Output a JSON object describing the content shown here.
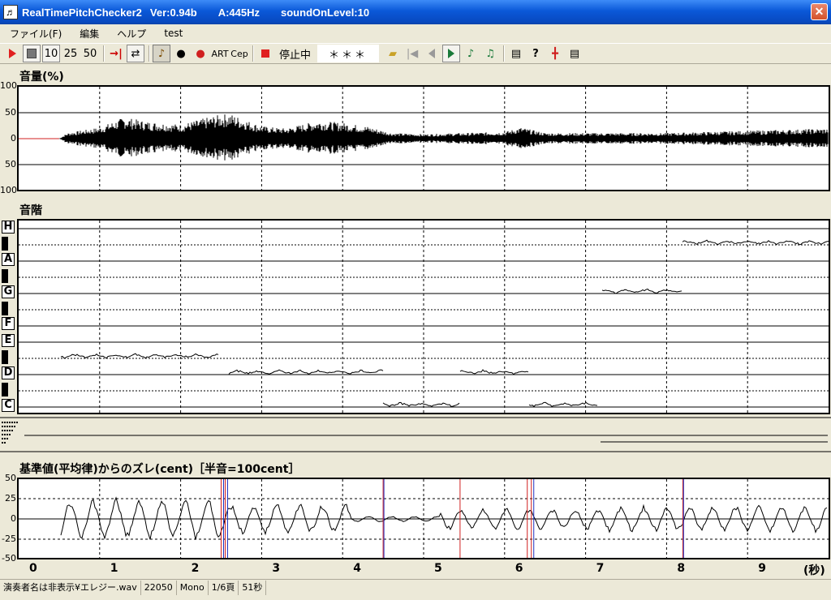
{
  "window": {
    "title_parts": [
      "RealTimePitchChecker2",
      "Ver:0.94b",
      "A:445Hz",
      "soundOnLevel:10"
    ],
    "close_glyph": "✕"
  },
  "menu": [
    "ファイル(F)",
    "編集",
    "ヘルプ",
    "test"
  ],
  "toolbar": {
    "speed_buttons": [
      "10",
      "25",
      "50"
    ],
    "art_label": "ART",
    "cep_label": "Cep",
    "state_label": "停止中",
    "display_value": "＊＊＊"
  },
  "panels": {
    "volume": {
      "title": "音量(%)",
      "yticks": [
        "100",
        "50",
        "0",
        "50",
        "100"
      ]
    },
    "scale": {
      "title": "音階",
      "notes": [
        "H",
        "A",
        "G",
        "F",
        "E",
        "D",
        "C"
      ]
    },
    "deviation": {
      "title": "基準値(平均律)からのズレ(cent)［半音=100cent］",
      "yticks": [
        "50",
        "25",
        "0",
        "-25",
        "-50"
      ]
    }
  },
  "x_axis": {
    "ticks": [
      "0",
      "1",
      "2",
      "3",
      "4",
      "5",
      "6",
      "7",
      "8",
      "9"
    ],
    "unit": "(秒)"
  },
  "status": [
    "演奏者名は非表示¥エレジー.wav",
    "22050",
    "Mono",
    "1/6頁",
    "51秒"
  ],
  "chart_data": [
    {
      "type": "area",
      "ylabel": "音量(%)",
      "ylim": [
        -100,
        100
      ],
      "xlim": [
        0,
        10
      ],
      "envelope": {
        "x": [
          0.0,
          0.5,
          0.6,
          1.0,
          1.3,
          1.6,
          2.0,
          2.4,
          2.6,
          3.0,
          3.3,
          3.7,
          4.0,
          4.3,
          4.6,
          5.0,
          5.5,
          6.0,
          6.2,
          6.5,
          7.0,
          7.5,
          8.0,
          8.5,
          9.0,
          9.5,
          10.0
        ],
        "amp": [
          0,
          0,
          10,
          20,
          38,
          30,
          25,
          40,
          45,
          22,
          18,
          32,
          28,
          22,
          10,
          8,
          10,
          12,
          20,
          10,
          10,
          10,
          10,
          12,
          14,
          16,
          18
        ]
      }
    },
    {
      "type": "line",
      "ylabel": "音階",
      "categories": [
        "C",
        "C#",
        "D",
        "D#",
        "E",
        "F",
        "F#",
        "G",
        "G#",
        "A",
        "A#",
        "H"
      ],
      "xlim": [
        0,
        10
      ],
      "pitch_segments": [
        {
          "x": [
            0.52,
            2.47
          ],
          "note": "D#"
        },
        {
          "x": [
            2.6,
            4.5
          ],
          "note": "D"
        },
        {
          "x": [
            4.5,
            5.45
          ],
          "note": "C"
        },
        {
          "x": [
            5.45,
            6.3
          ],
          "note": "D"
        },
        {
          "x": [
            6.3,
            7.15
          ],
          "note": "C"
        },
        {
          "x": [
            7.2,
            8.2
          ],
          "note": "G"
        },
        {
          "x": [
            8.2,
            10.0
          ],
          "note": "A#"
        }
      ]
    },
    {
      "type": "line",
      "ylabel": "cent",
      "ylim": [
        -50,
        50
      ],
      "xlim": [
        0,
        10
      ],
      "red_markers": [
        2.5,
        2.55,
        4.5,
        5.45,
        6.28,
        6.33,
        8.2
      ],
      "blue_markers": [
        2.52,
        2.57,
        4.5,
        6.35,
        8.2
      ]
    }
  ]
}
